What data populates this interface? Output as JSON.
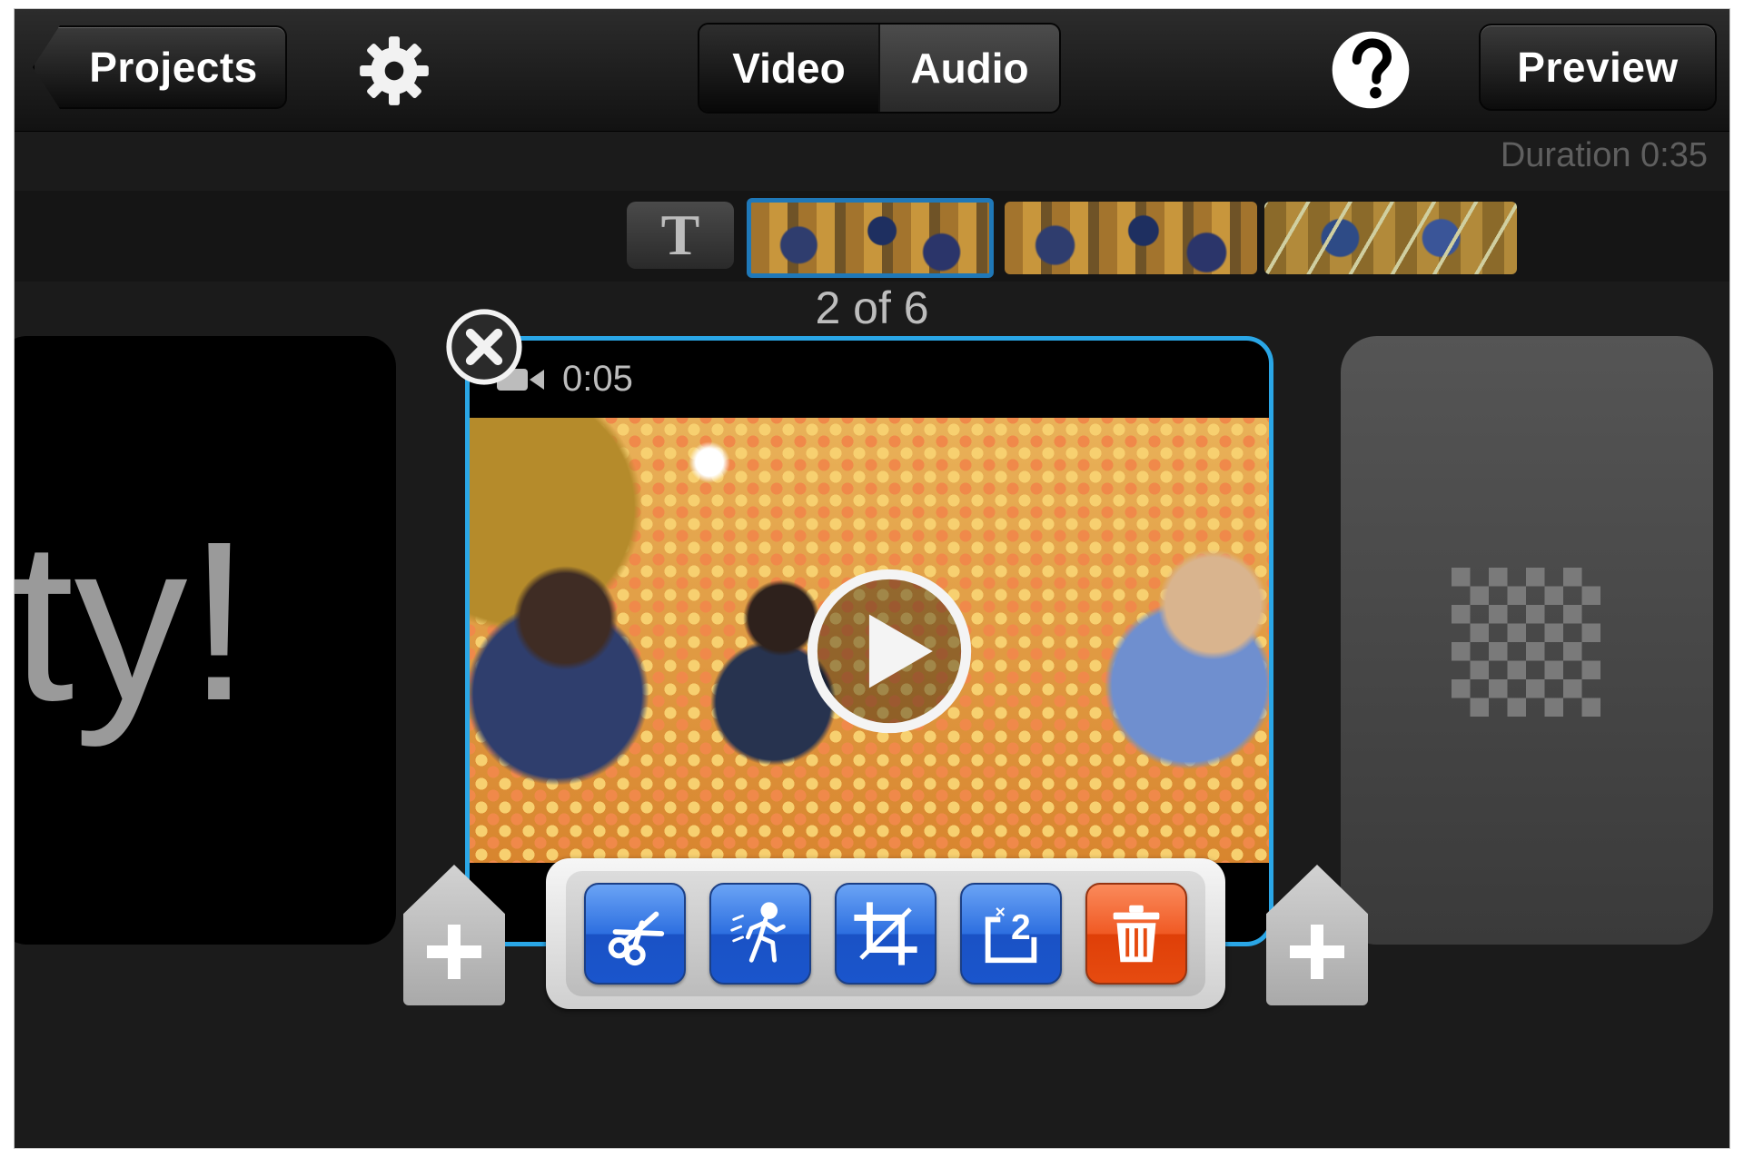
{
  "header": {
    "projects_label": "Projects",
    "settings_icon": "gear-icon",
    "tabs": [
      {
        "label": "Video",
        "selected": true
      },
      {
        "label": "Audio",
        "selected": false
      }
    ],
    "help_icon": "help-icon",
    "preview_label": "Preview"
  },
  "timeline": {
    "duration": "Duration 0:35",
    "title_clip_glyph": "T",
    "thumbnails": 3,
    "selected_thumbnail": 1
  },
  "clip": {
    "counter": "2 of 6",
    "length": "0:05",
    "previous_card_text": "rty!",
    "accent_color": "#2aa6e6"
  },
  "toolbar": {
    "tools": [
      {
        "name": "trim",
        "icon": "scissors-icon"
      },
      {
        "name": "effects",
        "icon": "running-figure-icon"
      },
      {
        "name": "crop",
        "icon": "crop-icon"
      },
      {
        "name": "speed",
        "icon": "speed-x2-icon"
      },
      {
        "name": "delete",
        "icon": "trash-icon",
        "color": "#f05a24"
      }
    ]
  }
}
